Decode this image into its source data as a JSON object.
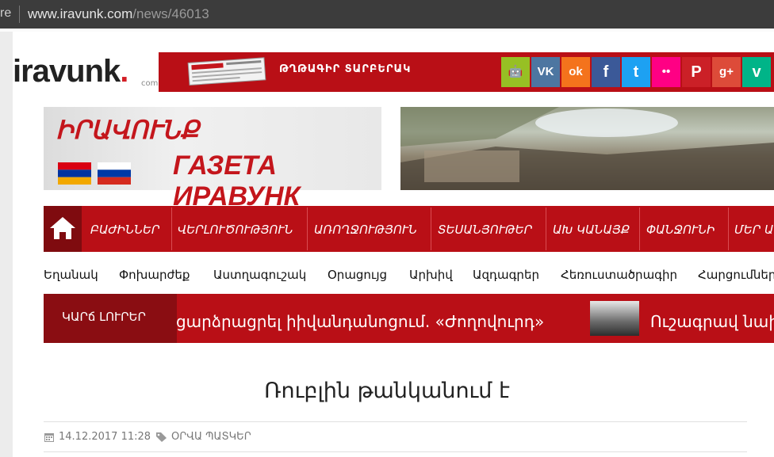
{
  "browser": {
    "left_fragment": "re",
    "url_domain": "www.iravunk.com",
    "url_path": "/news/46013"
  },
  "header": {
    "logo_text": "iravunk",
    "logo_dot": ".",
    "logo_suffix": "com",
    "redbar_label": "ԹՂԹԱԳԻՐ ՏԱՐԲԵՐԱԿ",
    "social": [
      {
        "name": "android-icon",
        "glyph": "🤖",
        "color": "#97c024"
      },
      {
        "name": "vk-icon",
        "glyph": "VK",
        "color": "#4d76a1"
      },
      {
        "name": "odnoklassniki-icon",
        "glyph": "ok",
        "color": "#f4731c"
      },
      {
        "name": "facebook-icon",
        "glyph": "f",
        "color": "#3b5998"
      },
      {
        "name": "twitter-icon",
        "glyph": "t",
        "color": "#1da1f2"
      },
      {
        "name": "flickr-icon",
        "glyph": "••",
        "color": "#ff0084"
      },
      {
        "name": "pinterest-icon",
        "glyph": "P",
        "color": "#cb2027"
      },
      {
        "name": "google-plus-icon",
        "glyph": "g+",
        "color": "#dd4b39"
      },
      {
        "name": "vine-icon",
        "glyph": "v",
        "color": "#00b488"
      }
    ]
  },
  "banner": {
    "title_arm": "ԻՐԱՎՈՒՆՔ",
    "title_rus": "ГАЗЕТА ИРАВУНК"
  },
  "nav": {
    "items": [
      "ԲԱԺԻՆՆԵՐ",
      "ՎԵՐԼՈՒԾՈՒԹՅՈՒՆ",
      "ԱՌՈՂՋՈՒԹՅՈՒՆ",
      "ՏԵՍԱՆՅՈՒԹԵՐ",
      "ԱԽ ԿԱՆԱՅՔ",
      "ՓԱՆՋՈՒՆԻ",
      "ՄԵՐ ԱՍ"
    ]
  },
  "subnav": {
    "items": [
      "Եղանակ",
      "Փոխարժեք",
      "Աստղագուշակ",
      "Օրացույց",
      "Արխիվ",
      "Ազդագրեր",
      "Հեռուստածրագիր",
      "Հարցումներ"
    ]
  },
  "ticker": {
    "label": "ԿԱՐճ ԼՈՒՐԵՐ",
    "text1": "ցարձրացրել իիվանդանոցում. «Ժողովուրդ»",
    "text2": "Ուշագրավ նախ"
  },
  "article": {
    "title": "Ռուբլին թանկանում է",
    "date": "14.12.2017 11:28",
    "category": "ՕՐՎԱ ՊԱՏԿԵՐ"
  },
  "colors": {
    "brand_red": "#b90f16",
    "brand_dark_red": "#7f0b0f"
  }
}
